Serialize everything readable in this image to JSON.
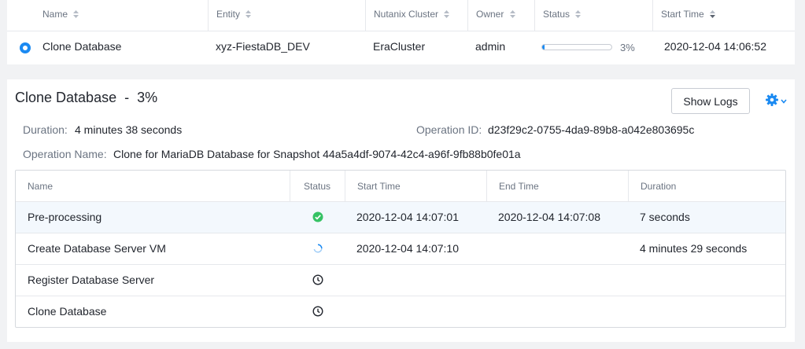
{
  "operations_table": {
    "columns": [
      "Name",
      "Entity",
      "Nutanix Cluster",
      "Owner",
      "Status",
      "Start Time"
    ],
    "rows": [
      {
        "name": "Clone Database",
        "entity": "xyz-FiestaDB_DEV",
        "cluster": "EraCluster",
        "owner": "admin",
        "progress": 0.03,
        "progress_text": "3%",
        "start_time": "2020-12-04 14:06:52"
      }
    ]
  },
  "detail": {
    "title": "Clone Database",
    "title_sep": "-",
    "percent": "3%",
    "show_logs_label": "Show Logs",
    "duration_label": "Duration:",
    "duration_value": "4 minutes 38 seconds",
    "operation_id_label": "Operation ID:",
    "operation_id_value": "d23f29c2-0755-4da9-89b8-a042e803695c",
    "operation_name_label": "Operation Name:",
    "operation_name_value": "Clone for MariaDB Database for Snapshot 44a5a4df-9074-42c4-a96f-9fb88b0fe01a",
    "gear_icon": "gear-icon",
    "accent_color": "#1b8af2"
  },
  "steps_table": {
    "columns": [
      "Name",
      "Status",
      "Start Time",
      "End Time",
      "Duration"
    ],
    "rows": [
      {
        "name": "Pre-processing",
        "status": "success-check-icon",
        "start_time": "2020-12-04 14:07:01",
        "end_time": "2020-12-04 14:07:08",
        "duration": "7 seconds"
      },
      {
        "name": "Create Database Server VM",
        "status": "loading-spinner-icon",
        "start_time": "2020-12-04 14:07:10",
        "end_time": "",
        "duration": "4 minutes 29 seconds"
      },
      {
        "name": "Register Database Server",
        "status": "pending-clock-icon",
        "start_time": "",
        "end_time": "",
        "duration": ""
      },
      {
        "name": "Clone Database",
        "status": "pending-clock-icon",
        "start_time": "",
        "end_time": "",
        "duration": ""
      }
    ]
  }
}
